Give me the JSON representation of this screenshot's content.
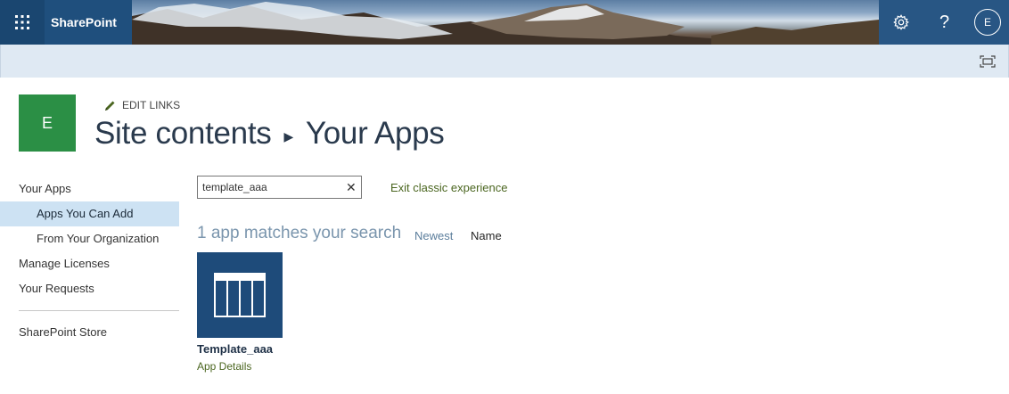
{
  "suite_bar": {
    "app_launcher_icon": "waffle-icon",
    "brand": "SharePoint",
    "settings_icon": "gear-icon",
    "help_label": "?",
    "avatar_initial": "E",
    "colors": {
      "bar": "#1f4f7d"
    }
  },
  "ribbon": {
    "focus_icon": "focus-on-content-icon"
  },
  "site": {
    "logo_initial": "E",
    "logo_color": "#2b8f45",
    "edit_links": "EDIT LINKS",
    "breadcrumb": [
      "Site contents",
      "Your Apps"
    ],
    "breadcrumb_separator_icon": "caret-right-icon"
  },
  "left_nav": {
    "items": [
      {
        "label": "Your Apps",
        "level": 0,
        "selected": false
      },
      {
        "label": "Apps You Can Add",
        "level": 1,
        "selected": true
      },
      {
        "label": "From Your Organization",
        "level": 1,
        "selected": false
      },
      {
        "label": "Manage Licenses",
        "level": 0,
        "selected": false
      },
      {
        "label": "Your Requests",
        "level": 0,
        "selected": false
      }
    ],
    "store": "SharePoint Store"
  },
  "search": {
    "value": "template_aaa",
    "clear_label": "✕"
  },
  "exit_classic": "Exit classic experience",
  "results": {
    "count_text": "1 app matches your search",
    "sort_options": [
      "Newest",
      "Name"
    ],
    "apps": [
      {
        "title": "Template_aaa",
        "details_link": "App Details",
        "icon": "custom-list-icon",
        "tile_color": "#1e4b7a"
      }
    ]
  }
}
